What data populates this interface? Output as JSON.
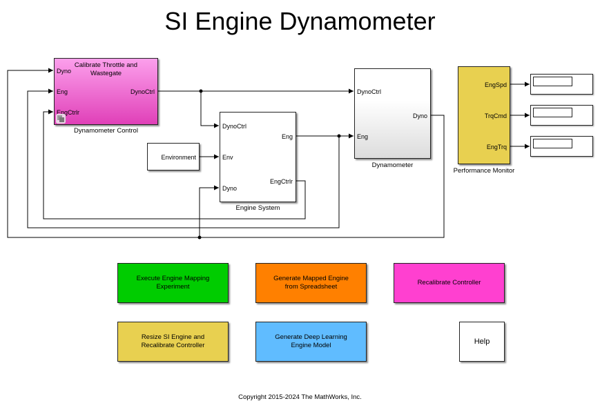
{
  "title": "SI Engine Dynamometer",
  "colors": {
    "dyno_control_top": "#fca0ec",
    "dyno_control_bottom": "#e040b8",
    "performance_monitor": "#e8d050",
    "btn_green": "#00cc00",
    "btn_orange": "#ff8000",
    "btn_magenta": "#ff40d0",
    "btn_yellow": "#e8d050",
    "btn_blue": "#60bcff"
  },
  "blocks": {
    "dyno_control": {
      "inner_text": "Calibrate Throttle and Wastegate",
      "label": "Dynamometer Control",
      "inputs": [
        "Dyno",
        "Eng",
        "EngCtrlr"
      ],
      "outputs": [
        "DynoCtrl"
      ]
    },
    "engine_system": {
      "label": "Engine System",
      "inputs": [
        "DynoCtrl",
        "Env",
        "Dyno"
      ],
      "outputs": [
        "Eng",
        "EngCtrlr"
      ]
    },
    "environment": {
      "outputs": [
        "Environment"
      ]
    },
    "dynamometer": {
      "label": "Dynamometer",
      "inputs": [
        "DynoCtrl",
        "Eng"
      ],
      "outputs": [
        "Dyno"
      ]
    },
    "performance_monitor": {
      "label": "Performance Monitor",
      "outputs": [
        "EngSpd",
        "TrqCmd",
        "EngTrq"
      ]
    }
  },
  "buttons": [
    {
      "id": "execute-mapping",
      "lines": [
        "Execute Engine Mapping",
        "Experiment"
      ]
    },
    {
      "id": "generate-mapped",
      "lines": [
        "Generate Mapped Engine",
        "from Spreadsheet"
      ]
    },
    {
      "id": "recalibrate",
      "lines": [
        "Recalibrate Controller"
      ]
    },
    {
      "id": "resize",
      "lines": [
        "Resize SI Engine and",
        "Recalibrate Controller"
      ]
    },
    {
      "id": "deep-learning",
      "lines": [
        "Generate Deep Learning",
        "Engine Model"
      ]
    },
    {
      "id": "help",
      "lines": [
        "Help"
      ]
    }
  ],
  "displays": [
    {
      "signal": "EngSpd",
      "value": ""
    },
    {
      "signal": "TrqCmd",
      "value": ""
    },
    {
      "signal": "EngTrq",
      "value": ""
    }
  ],
  "copyright": "Copyright 2015-2024 The MathWorks, Inc."
}
